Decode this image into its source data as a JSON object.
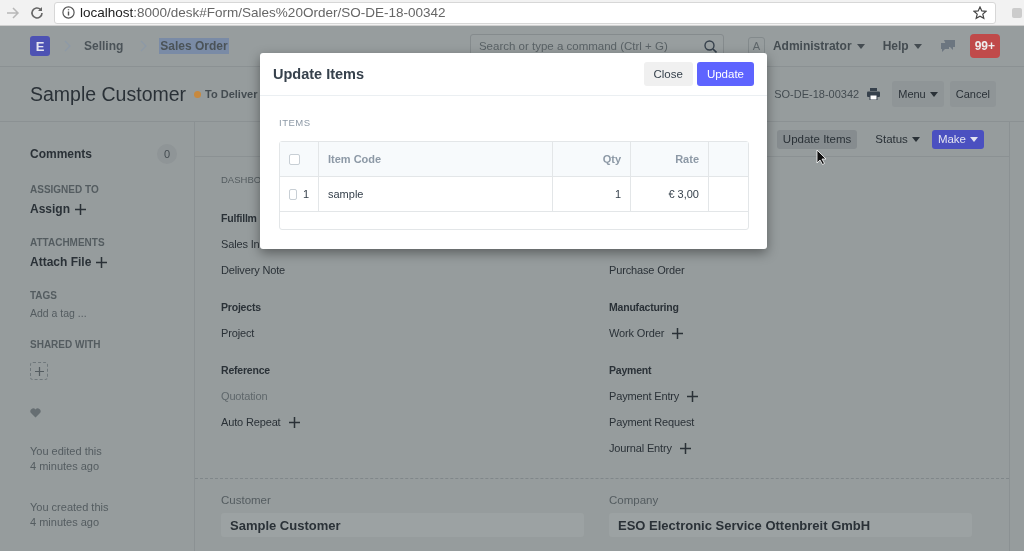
{
  "browser": {
    "url_host": "localhost",
    "url_path": ":8000/desk#Form/Sales%20Order/SO-DE-18-00342"
  },
  "navbar": {
    "logo": "E",
    "breadcrumbs": [
      {
        "label": "Selling",
        "text_selected": false
      },
      {
        "label": "Sales Order",
        "text_selected": true
      }
    ],
    "search": {
      "placeholder": "Search or type a command (Ctrl + G)"
    },
    "avatar": "A",
    "user": "Administrator",
    "help": "Help",
    "notifications": "99+"
  },
  "page_head": {
    "title": "Sample Customer",
    "status": {
      "label": "To Deliver",
      "color": "#c8893e"
    },
    "doc_name": "SO-DE-18-00342",
    "buttons": [
      {
        "label": "Menu",
        "dropdown": true
      },
      {
        "label": "Cancel",
        "dropdown": false
      }
    ]
  },
  "sidebar": {
    "comments": {
      "label": "Comments",
      "count": "0"
    },
    "sections": [
      {
        "kind": "action",
        "heading": "ASSIGNED TO",
        "label": "Assign"
      },
      {
        "kind": "action",
        "heading": "ATTACHMENTS",
        "label": "Attach File"
      },
      {
        "kind": "tags",
        "heading": "TAGS",
        "placeholder": "Add a tag ..."
      },
      {
        "kind": "share",
        "heading": "SHARED WITH"
      }
    ],
    "activity": [
      {
        "text": "You edited this",
        "time": "4 minutes ago"
      },
      {
        "text": "You created this",
        "time": "4 minutes ago"
      }
    ]
  },
  "toolbar": [
    {
      "label": "Update Items",
      "kind": "default",
      "dropdown": false
    },
    {
      "label": "Status",
      "kind": "text",
      "dropdown": true
    },
    {
      "label": "Make",
      "kind": "primary",
      "dropdown": true
    }
  ],
  "dashboard": {
    "heading": "DASHBO",
    "groups": [
      {
        "title": "Fulfillm",
        "links": [
          {
            "label": "Sales In",
            "add": false,
            "disabled": false
          },
          {
            "label": "Delivery Note",
            "add": false,
            "disabled": false
          }
        ]
      },
      {
        "links": [
          {
            "label": "Purchase Order",
            "add": false,
            "disabled": false
          }
        ]
      },
      {
        "title": "Projects",
        "links": [
          {
            "label": "Project",
            "add": false,
            "disabled": false
          }
        ]
      },
      {
        "title": "Manufacturing",
        "links": [
          {
            "label": "Work Order",
            "add": true,
            "disabled": false
          }
        ]
      },
      {
        "title": "Reference",
        "links": [
          {
            "label": "Quotation",
            "add": false,
            "disabled": true
          },
          {
            "label": "Auto Repeat",
            "add": true,
            "disabled": false
          }
        ]
      },
      {
        "title": "Payment",
        "links": [
          {
            "label": "Payment Entry",
            "add": true,
            "disabled": false
          },
          {
            "label": "Payment Request",
            "add": false,
            "disabled": false
          },
          {
            "label": "Journal Entry",
            "add": true,
            "disabled": false
          }
        ]
      }
    ]
  },
  "form": {
    "fields": [
      {
        "label": "Customer",
        "value": "Sample Customer"
      },
      {
        "label": "Company",
        "value": "ESO Electronic Service Ottenbreit GmbH"
      }
    ]
  },
  "dialog": {
    "title": "Update Items",
    "buttons": [
      {
        "label": "Close",
        "kind": "default"
      },
      {
        "label": "Update",
        "kind": "primary"
      }
    ],
    "section": "ITEMS",
    "table": {
      "select_all": false,
      "columns": [
        "Item Code",
        "Qty",
        "Rate"
      ],
      "rows": [
        {
          "index": "1",
          "checked": false,
          "cells": [
            "sample",
            "1",
            "€ 3,00"
          ]
        }
      ]
    }
  }
}
